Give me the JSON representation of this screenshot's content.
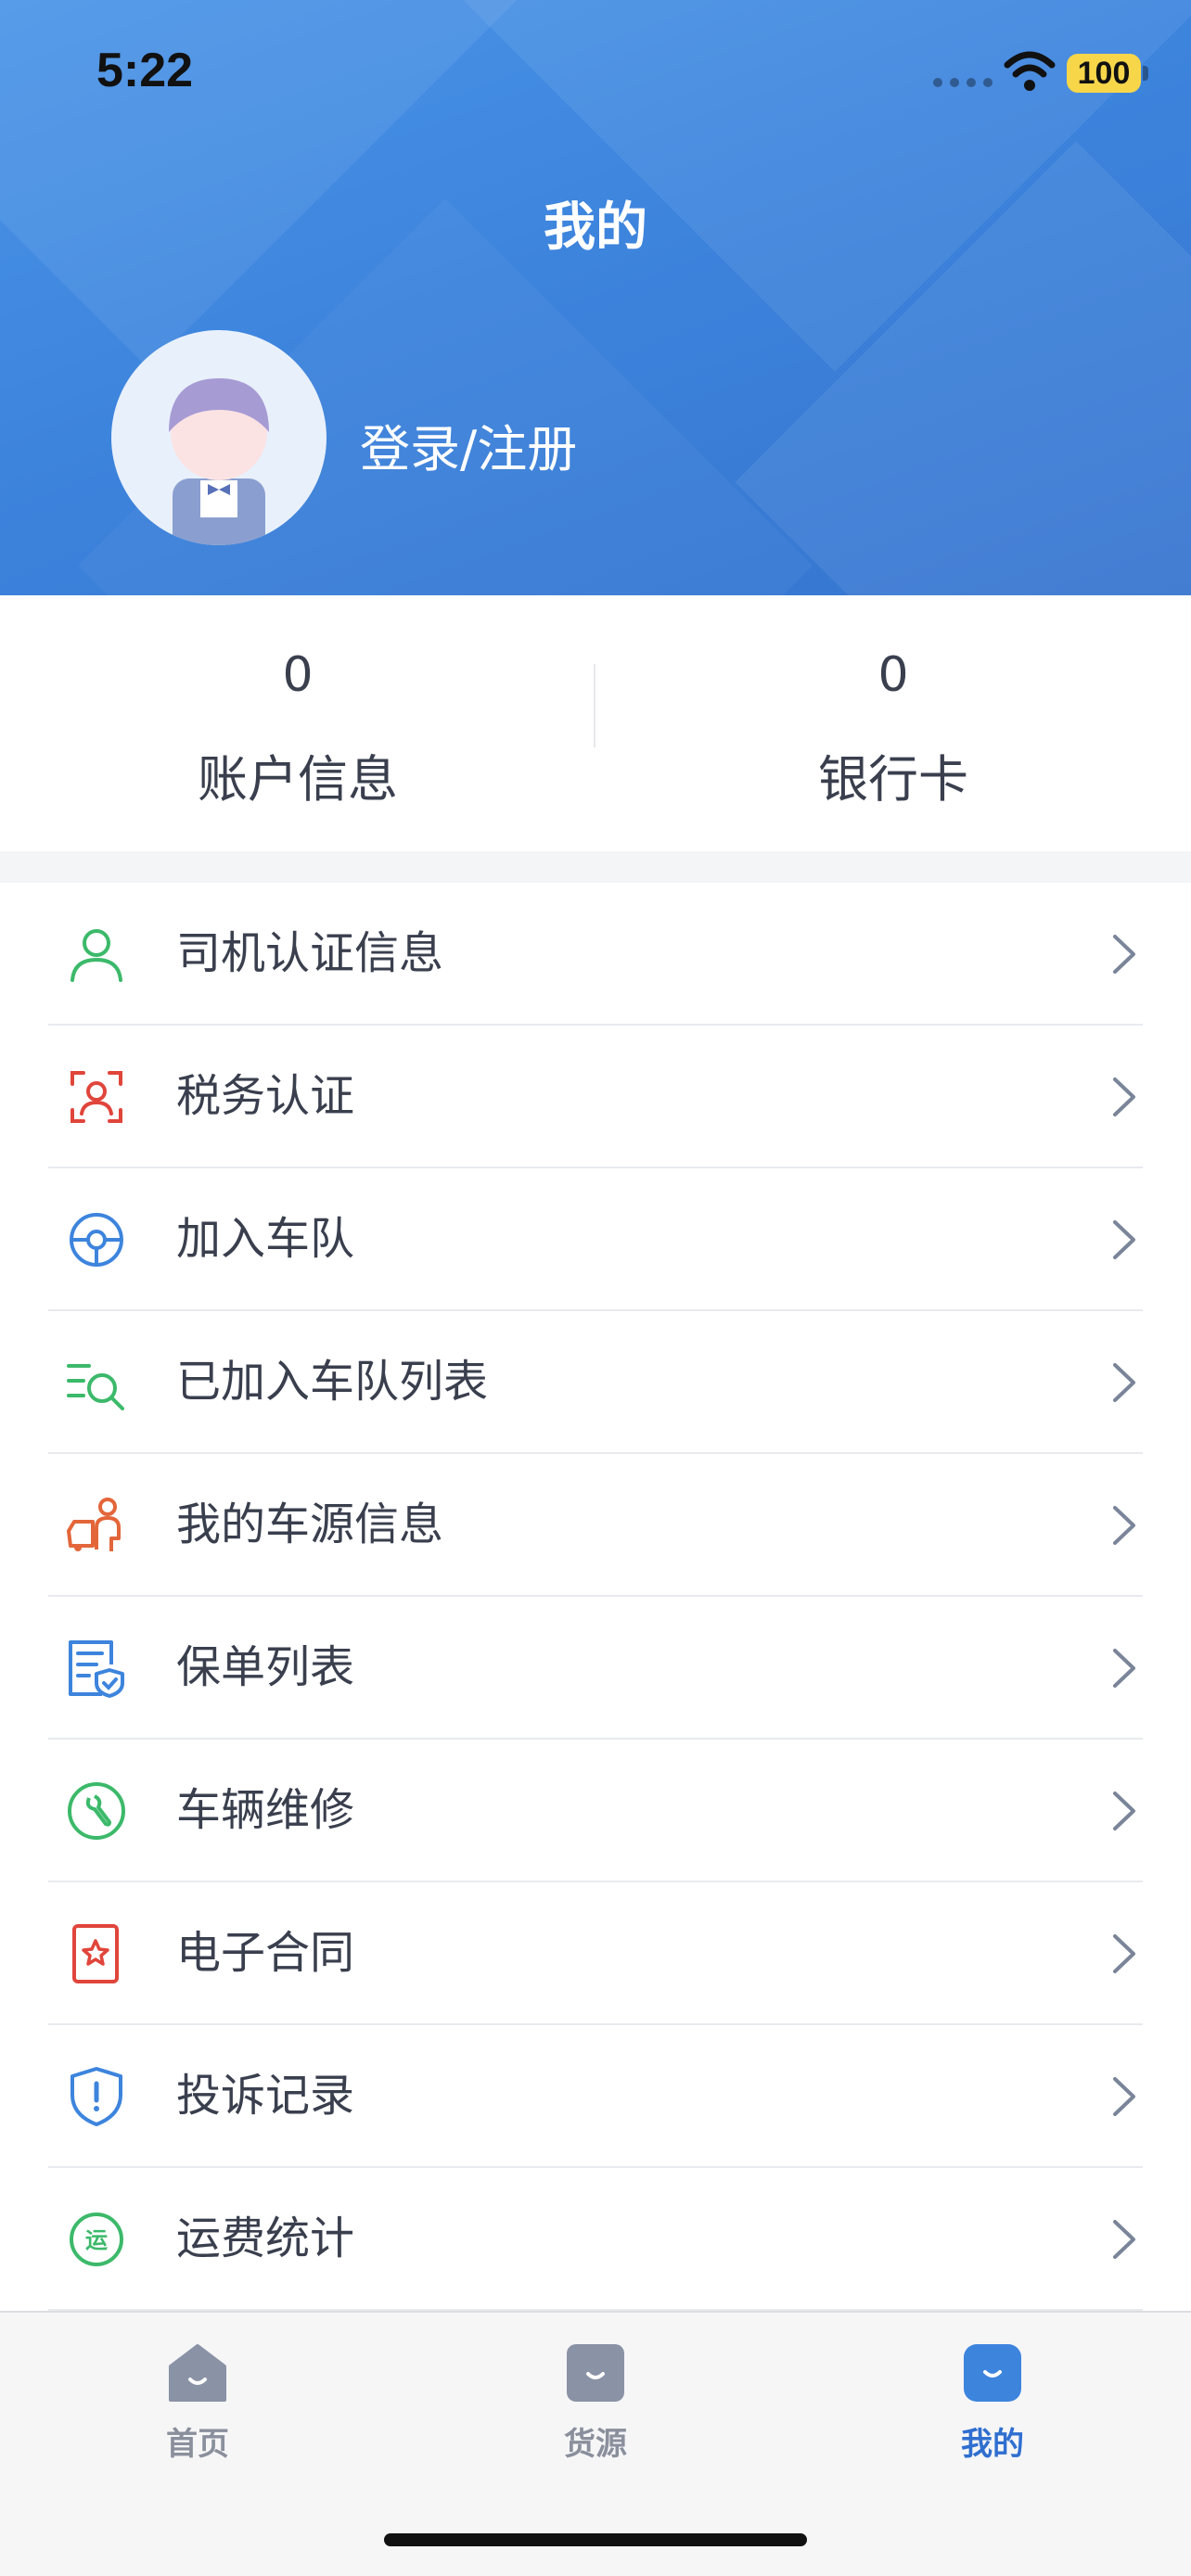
{
  "status_bar": {
    "time": "5:22",
    "battery": "100"
  },
  "header": {
    "title": "我的",
    "login_label": "登录/注册"
  },
  "stats": [
    {
      "value": "0",
      "label": "账户信息"
    },
    {
      "value": "0",
      "label": "银行卡"
    }
  ],
  "menu": [
    {
      "label": "司机认证信息",
      "icon": "driver-auth-icon",
      "color": "#3cb96a"
    },
    {
      "label": "税务认证",
      "icon": "tax-auth-icon",
      "color": "#e0453b"
    },
    {
      "label": "加入车队",
      "icon": "steering-wheel-icon",
      "color": "#3d84dd"
    },
    {
      "label": "已加入车队列表",
      "icon": "list-search-icon",
      "color": "#3cb96a"
    },
    {
      "label": "我的车源信息",
      "icon": "vehicle-source-icon",
      "color": "#e3663a"
    },
    {
      "label": "保单列表",
      "icon": "policy-list-icon",
      "color": "#3d84dd"
    },
    {
      "label": "车辆维修",
      "icon": "wrench-icon",
      "color": "#3cb96a"
    },
    {
      "label": "电子合同",
      "icon": "contract-icon",
      "color": "#e0453b"
    },
    {
      "label": "投诉记录",
      "icon": "shield-alert-icon",
      "color": "#3d84dd"
    },
    {
      "label": "运费统计",
      "icon": "freight-stats-icon",
      "color": "#3cb96a",
      "badge": "运"
    }
  ],
  "tabbar": {
    "items": [
      {
        "label": "首页",
        "icon": "home-icon",
        "active": false
      },
      {
        "label": "货源",
        "icon": "cargo-icon",
        "active": false
      },
      {
        "label": "我的",
        "icon": "profile-icon",
        "active": true
      }
    ],
    "active_color": "#2f6fd0",
    "inactive_color": "#8a8f9c"
  }
}
